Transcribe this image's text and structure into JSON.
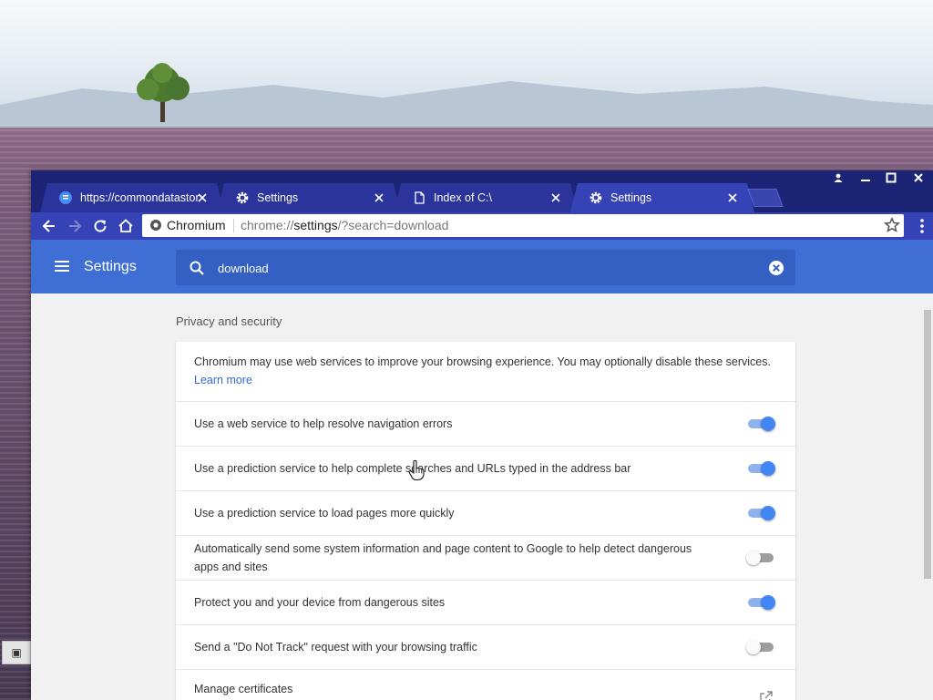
{
  "desktop": {
    "icon_label": "▣"
  },
  "tabs": [
    {
      "title": "https://commondatastor",
      "icon": "document-blue-icon"
    },
    {
      "title": "Settings",
      "icon": "gear-icon"
    },
    {
      "title": "Index of C:\\",
      "icon": "page-icon"
    },
    {
      "title": "Settings",
      "icon": "gear-icon"
    }
  ],
  "omnibox": {
    "site_label": "Chromium",
    "url_prefix": "chrome://",
    "url_strong": "settings",
    "url_suffix": "/?search=download"
  },
  "header": {
    "title": "Settings",
    "search_value": "download"
  },
  "section": {
    "title": "Privacy and security",
    "intro": "Chromium may use web services to improve your browsing experience. You may optionally disable these services.",
    "learn_more": "Learn more",
    "rows": [
      {
        "label": "Use a web service to help resolve navigation errors",
        "enabled": true
      },
      {
        "label": "Use a prediction service to help complete searches and URLs typed in the address bar",
        "enabled": true
      },
      {
        "label": "Use a prediction service to load pages more quickly",
        "enabled": true
      },
      {
        "label": "Automatically send some system information and page content to Google to help detect dangerous apps and sites",
        "enabled": false
      },
      {
        "label": "Protect you and your device from dangerous sites",
        "enabled": true
      },
      {
        "label": "Send a \"Do Not Track\" request with your browsing traffic",
        "enabled": false
      }
    ],
    "manage_certificates": "Manage certificates"
  },
  "colors": {
    "frame": "#1c2575",
    "toolbar": "#3643b6",
    "header": "#3f6fd4",
    "toggle_on": "#4285f4"
  }
}
